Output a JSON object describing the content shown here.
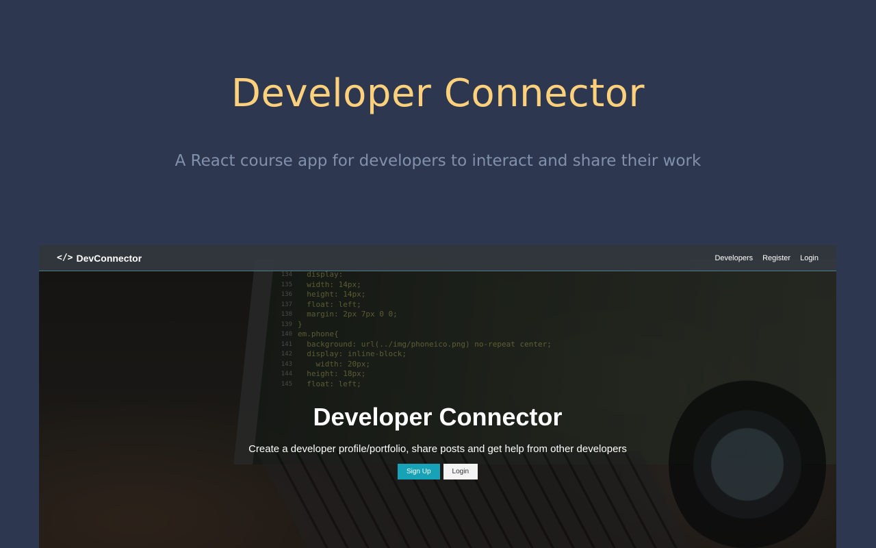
{
  "hero": {
    "title": "Developer Connector",
    "subtitle": "A React course app for developers to interact and share their work"
  },
  "app": {
    "navbar": {
      "brand": "DevConnector",
      "brand_icon": "</>",
      "links": [
        "Developers",
        "Register",
        "Login"
      ]
    },
    "landing": {
      "title": "Developer Connector",
      "lead": "Create a developer profile/portfolio, share posts and get help from other developers",
      "signup_label": "Sign Up",
      "login_label": "Login"
    }
  },
  "colors": {
    "background": "#2d3850",
    "hero_title": "#fdd07c",
    "hero_subtitle": "#8290ab",
    "primary_button": "#17a2b8",
    "navbar": "#343a40"
  }
}
